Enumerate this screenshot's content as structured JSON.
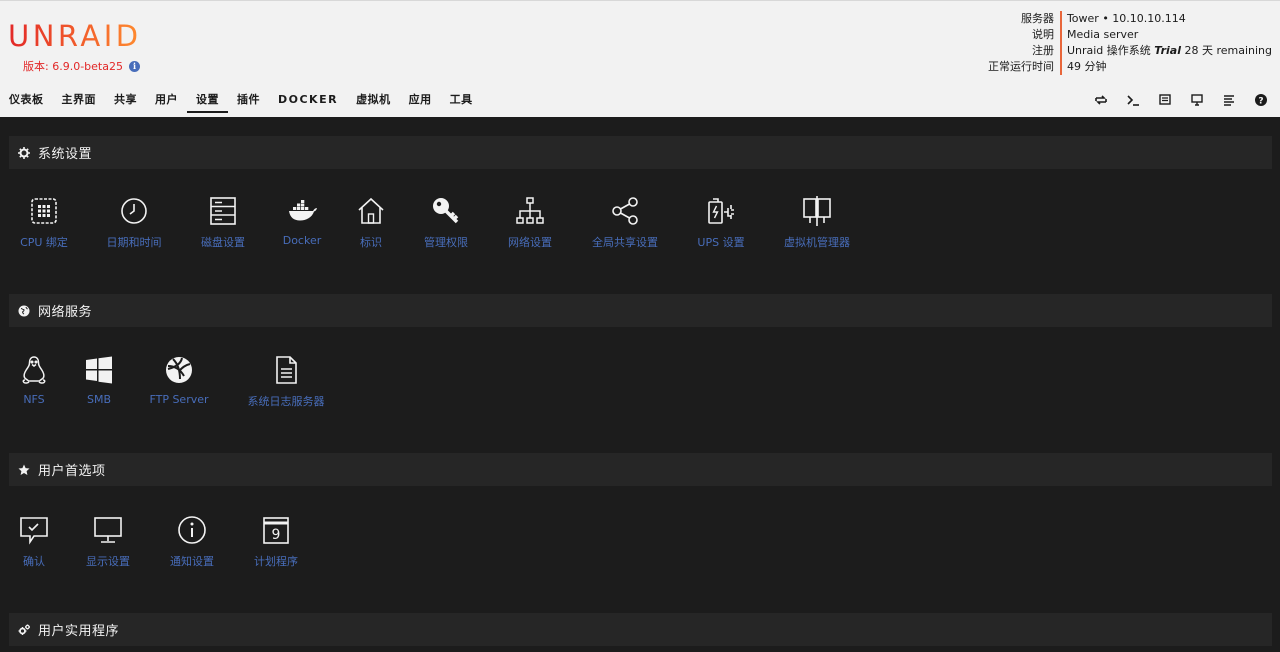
{
  "header": {
    "logo": "UNRAID",
    "version": "版本: 6.9.0-beta25",
    "server": {
      "labels": [
        "服务器",
        "说明",
        "注册",
        "正常运行时间"
      ],
      "values": {
        "server": "Tower • 10.10.10.114",
        "description": "Media server",
        "reg_prefix": "Unraid 操作系统 ",
        "reg_trial": "Trial",
        "reg_suffix": " 28 天 remaining",
        "uptime": "49 分钟"
      }
    }
  },
  "nav": {
    "items": [
      "仪表板",
      "主界面",
      "共享",
      "用户",
      "设置",
      "插件",
      "DOCKER",
      "虚拟机",
      "应用",
      "工具"
    ],
    "active": "设置",
    "icons": [
      "refresh-icon",
      "terminal-icon",
      "feedback-icon",
      "monitor-icon",
      "log-icon",
      "help-icon"
    ]
  },
  "sections": [
    {
      "title": "系统设置",
      "icon": "gear-icon",
      "tiles": [
        {
          "label": "CPU 绑定",
          "icon": "cpu-icon"
        },
        {
          "label": "日期和时间",
          "icon": "clock-icon"
        },
        {
          "label": "磁盘设置",
          "icon": "disk-icon"
        },
        {
          "label": "Docker",
          "icon": "docker-icon"
        },
        {
          "label": "标识",
          "icon": "home-icon"
        },
        {
          "label": "管理权限",
          "icon": "key-icon"
        },
        {
          "label": "网络设置",
          "icon": "network-icon"
        },
        {
          "label": "全局共享设置",
          "icon": "share-icon"
        },
        {
          "label": "UPS 设置",
          "icon": "battery-icon"
        },
        {
          "label": "虚拟机管理器",
          "icon": "vm-icon"
        }
      ]
    },
    {
      "title": "网络服务",
      "icon": "globe-icon",
      "tiles": [
        {
          "label": "NFS",
          "icon": "linux-icon"
        },
        {
          "label": "SMB",
          "icon": "windows-icon"
        },
        {
          "label": "FTP Server",
          "icon": "ftp-icon"
        },
        {
          "label": "系统日志服务器",
          "icon": "file-icon"
        }
      ]
    },
    {
      "title": "用户首选项",
      "icon": "star-icon",
      "tiles": [
        {
          "label": "确认",
          "icon": "confirm-icon"
        },
        {
          "label": "显示设置",
          "icon": "display-icon"
        },
        {
          "label": "通知设置",
          "icon": "info-icon"
        },
        {
          "label": "计划程序",
          "icon": "calendar-icon"
        }
      ]
    },
    {
      "title": "用户实用程序",
      "icon": "cogs-icon",
      "tiles": []
    }
  ],
  "colors": {
    "accent": "#e8663a",
    "link": "#486dba",
    "header_bg": "#f2f2f2",
    "page_bg": "#1c1c1c",
    "section_bg": "#262626"
  }
}
